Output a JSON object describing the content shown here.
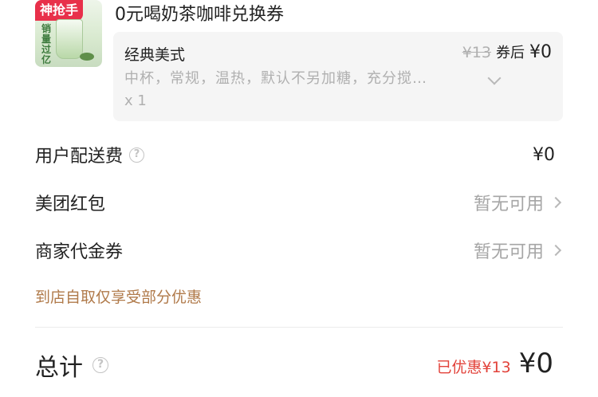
{
  "product": {
    "badge": "神抢手",
    "thumb_text": "销量过亿",
    "title": "0元喝奶茶咖啡兑换券",
    "spec_name": "经典美式",
    "spec_detail": "中杯，常规，温热，默认不另加糖，充分搅…",
    "quantity": "x 1",
    "original_price": "¥13",
    "after_coupon_label": "券后",
    "after_coupon_price": "¥0"
  },
  "rows": {
    "delivery_fee_label": "用户配送费",
    "delivery_fee_value": "¥0",
    "meituan_redpacket_label": "美团红包",
    "meituan_redpacket_value": "暂无可用",
    "merchant_voucher_label": "商家代金券",
    "merchant_voucher_value": "暂无可用"
  },
  "pickup_note": "到店自取仅享受部分优惠",
  "total": {
    "label": "总计",
    "discount_text": "已优惠¥13",
    "amount": "¥0"
  },
  "icons": {
    "help": "question-circle-icon",
    "chevron": "chevron-right-icon",
    "expand": "chevron-down-icon"
  },
  "colors": {
    "badge": "#e8304a",
    "discount": "#e2423a",
    "note": "#b07a4a"
  }
}
